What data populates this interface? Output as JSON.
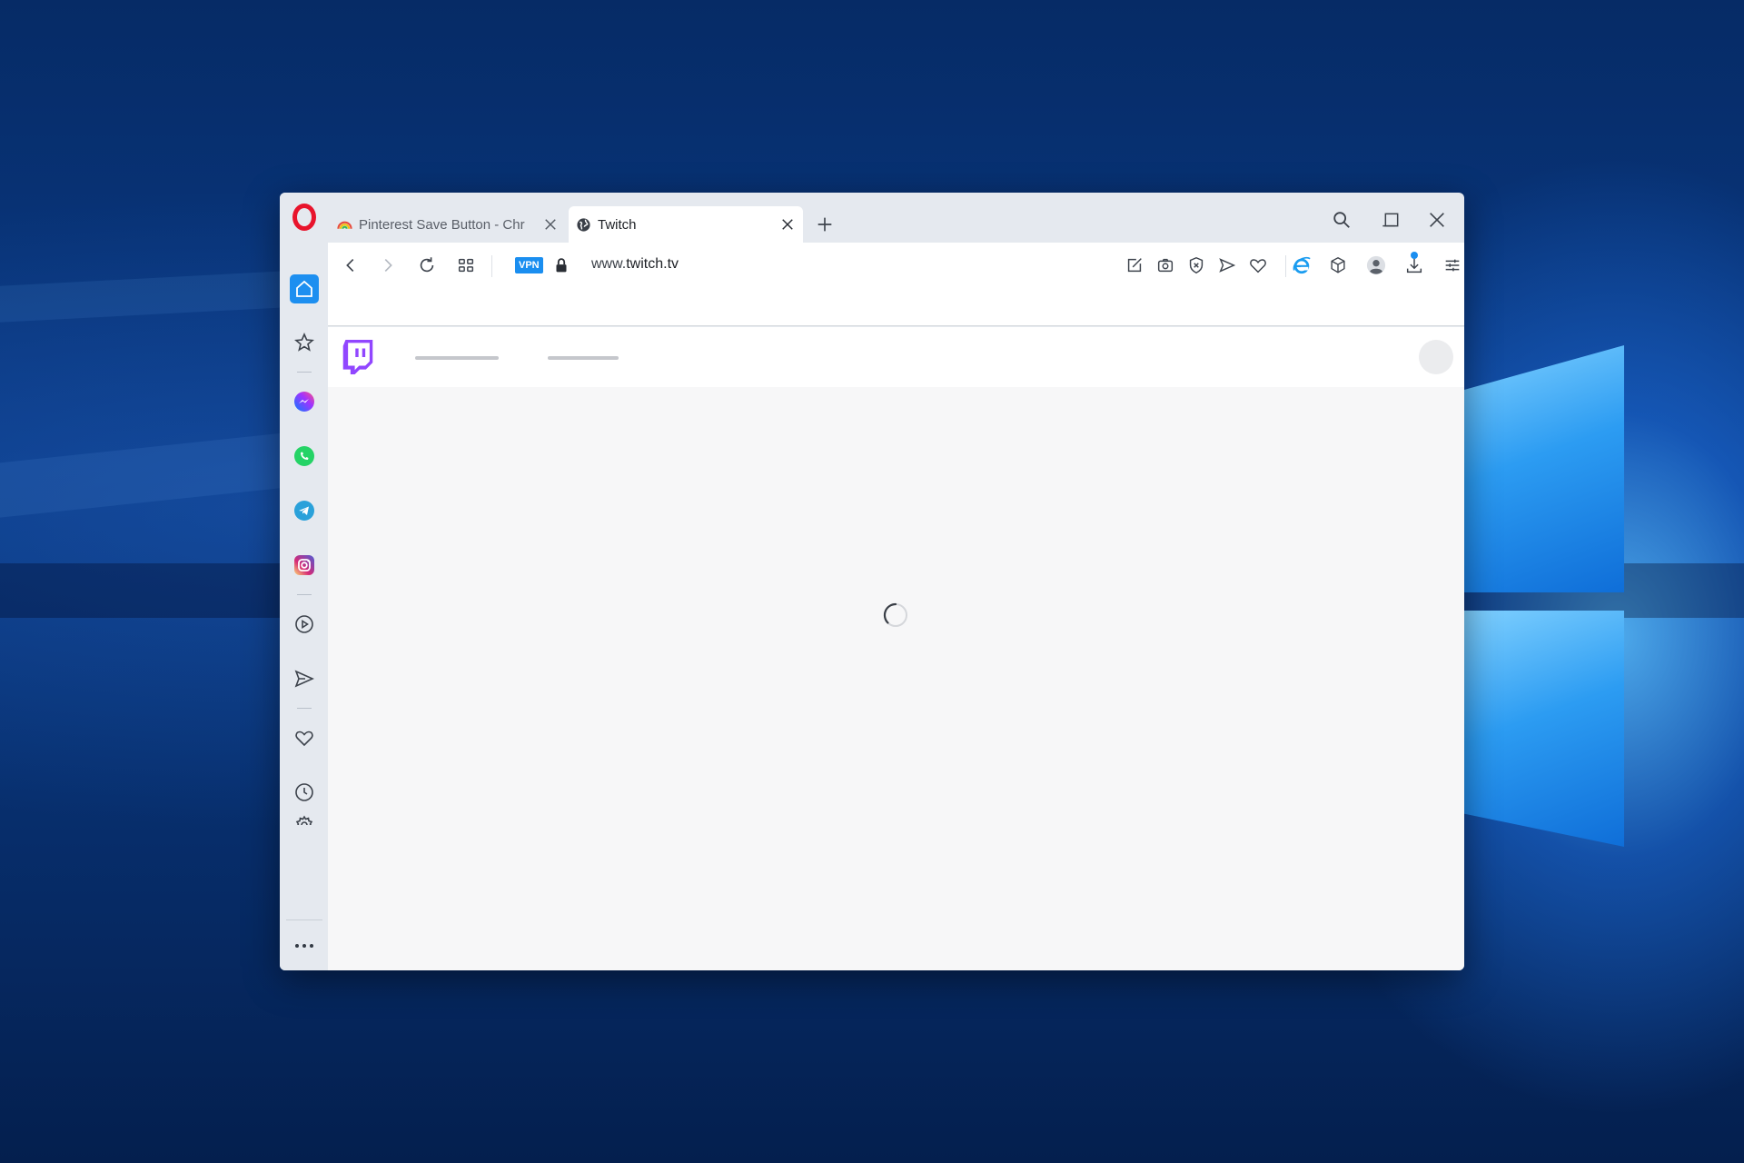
{
  "browser": {
    "tabs": [
      {
        "title": "Pinterest Save Button - Chr",
        "active": false
      },
      {
        "title": "Twitch",
        "active": true
      }
    ],
    "vpn_label": "VPN",
    "url": {
      "prefix": "www.",
      "host": "twitch.tv"
    }
  },
  "sidebar": {
    "items": [
      {
        "icon": "home-icon",
        "active": true
      },
      {
        "icon": "star-icon"
      },
      {
        "icon": "messenger-icon"
      },
      {
        "icon": "whatsapp-icon"
      },
      {
        "icon": "telegram-icon"
      },
      {
        "icon": "instagram-icon"
      },
      {
        "icon": "player-icon"
      },
      {
        "icon": "flow-send-icon"
      },
      {
        "icon": "heart-icon"
      },
      {
        "icon": "history-icon"
      },
      {
        "icon": "settings-icon"
      }
    ]
  },
  "colors": {
    "opera_red": "#e8142c",
    "accent_blue": "#1a8ef0",
    "twitch_purple": "#9146ff"
  },
  "page": {
    "state": "loading"
  }
}
